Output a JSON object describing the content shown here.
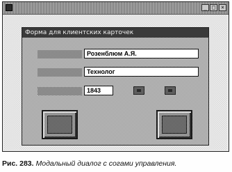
{
  "window": {
    "minimize_glyph": "_",
    "maximize_glyph": "□",
    "close_glyph": "×"
  },
  "dialog": {
    "title": "Форма для клиентских карточек",
    "name_value": "Розенблюм А.Я.",
    "position_value": "Технолог",
    "year_value": "1843"
  },
  "caption": {
    "figure_number": "Рис. 283.",
    "text": " Модальный диалог с согами управления."
  }
}
